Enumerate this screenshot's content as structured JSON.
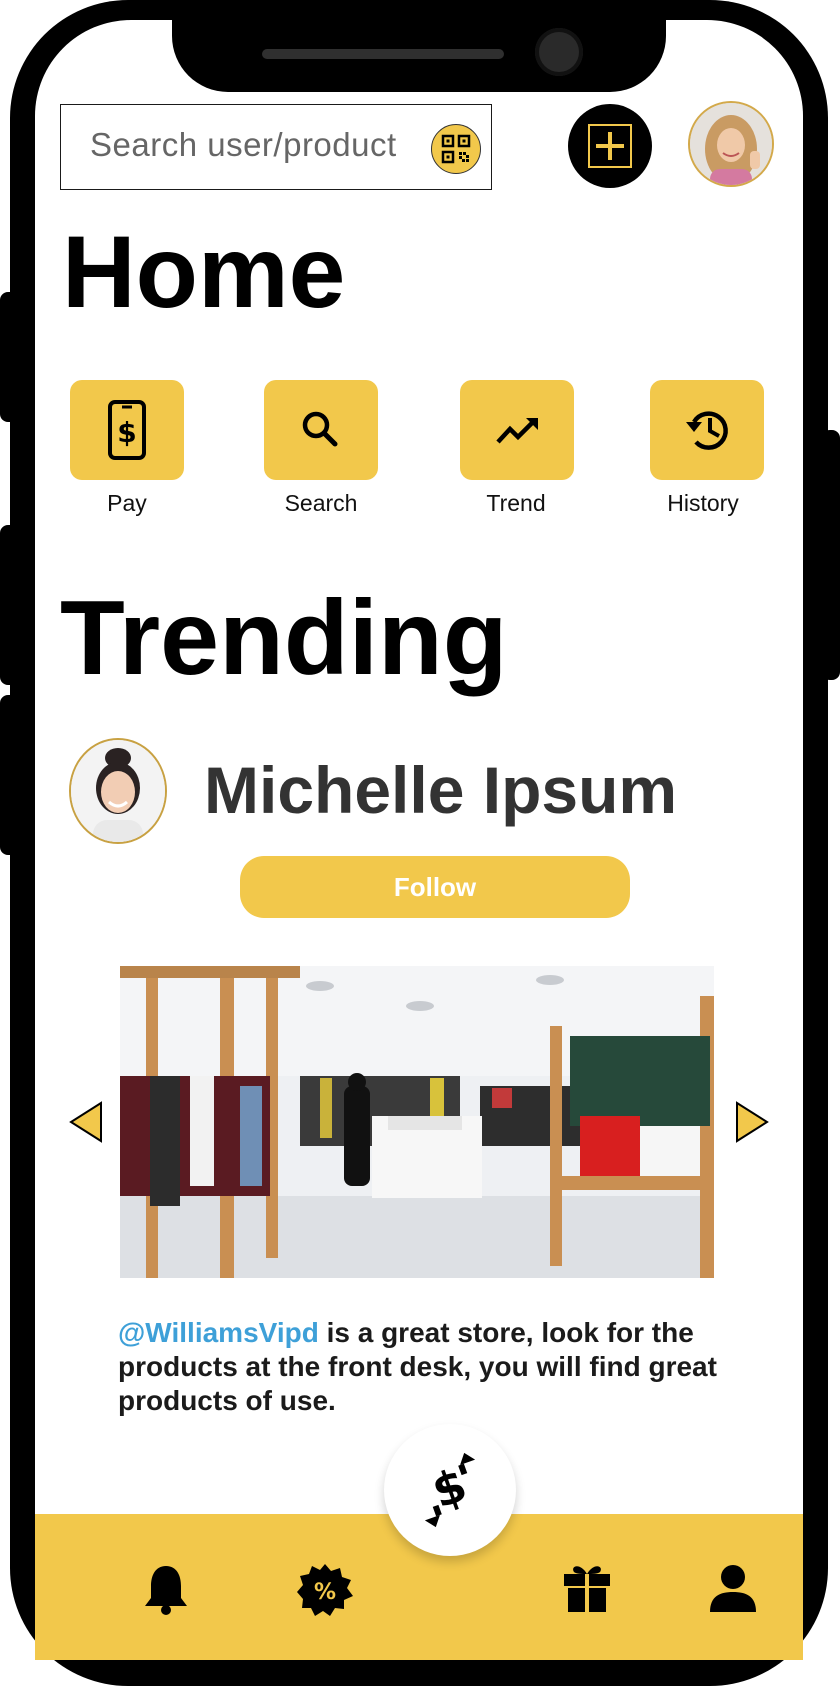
{
  "search": {
    "placeholder": "Search user/product"
  },
  "home": {
    "title": "Home"
  },
  "quick_actions": [
    {
      "label": "Pay",
      "icon": "pay-phone-dollar-icon"
    },
    {
      "label": "Search",
      "icon": "search-icon"
    },
    {
      "label": "Trend",
      "icon": "trend-icon"
    },
    {
      "label": "History",
      "icon": "history-icon"
    }
  ],
  "trending": {
    "title": "Trending",
    "user_name": "Michelle Ipsum",
    "follow_label": "Follow",
    "post": {
      "mention": "@WilliamsVipd",
      "text": " is a great store, look for the products at the front desk, you will find great products of use."
    }
  },
  "bottom_nav": [
    {
      "icon": "bell-icon"
    },
    {
      "icon": "discount-badge-icon"
    },
    {
      "icon": "money-exchange-icon"
    },
    {
      "icon": "gift-icon"
    },
    {
      "icon": "profile-icon"
    }
  ],
  "colors": {
    "accent": "#f2c84b",
    "mention": "#3ea0d8",
    "frame": "#000000"
  }
}
